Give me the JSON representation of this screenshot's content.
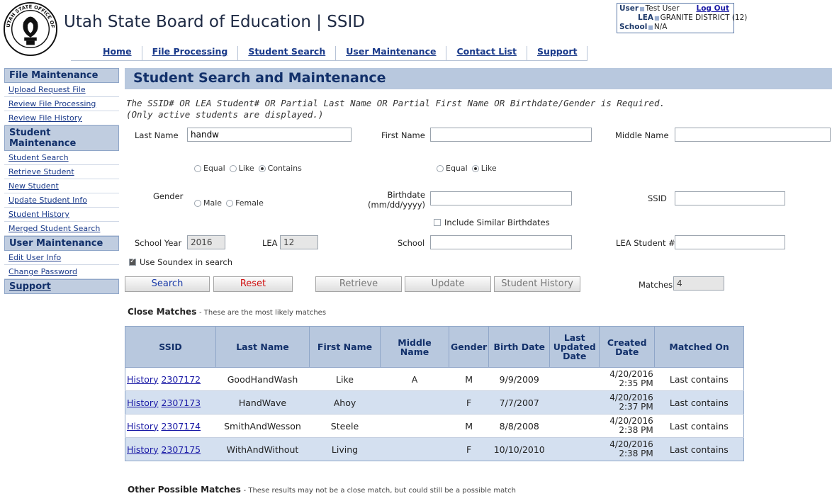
{
  "header": {
    "title": "Utah State Board of Education | SSID",
    "logo_text": "UTAH STATE OFFICE OF EDUCATION",
    "user_label": "User",
    "user_value": "Test User",
    "logout": "Log Out",
    "lea_label": "LEA",
    "lea_value": "GRANITE DISTRICT (12)",
    "school_label": "School",
    "school_value": "N/A",
    "nav": [
      "Home",
      "File Processing",
      "Student Search",
      "User Maintenance",
      "Contact List",
      "Support"
    ]
  },
  "sidebar": {
    "file_header": "File Maintenance",
    "file_items": [
      "Upload Request File",
      "Review File Processing",
      "Review File History"
    ],
    "student_header": "Student Maintenance",
    "student_items": [
      "Student Search",
      "Retrieve Student",
      "New Student",
      "Update Student Info",
      "Student History",
      "Merged Student Search"
    ],
    "user_header": "User Maintenance",
    "user_items": [
      "Edit User Info",
      "Change Password"
    ],
    "support_header": "Support"
  },
  "main": {
    "title": "Student Search and Maintenance",
    "instruction_1": "The SSID# OR LEA Student# OR Partial Last Name OR Partial First Name OR Birthdate/Gender is Required.",
    "instruction_2": "(Only active students are displayed.)"
  },
  "form": {
    "last_name_label": "Last Name",
    "last_name_value": "handw",
    "first_name_label": "First Name",
    "first_name_value": "",
    "middle_name_label": "Middle Name",
    "middle_name_value": "",
    "last_match_options": [
      "Equal",
      "Like",
      "Contains"
    ],
    "last_match_selected": "Contains",
    "first_match_options": [
      "Equal",
      "Like"
    ],
    "first_match_selected": "Like",
    "gender_label": "Gender",
    "gender_options": [
      "Male",
      "Female"
    ],
    "birthdate_label": "Birthdate",
    "birthdate_hint": "(mm/dd/yyyy)",
    "ssid_label": "SSID",
    "include_similar_label": "Include Similar Birthdates",
    "include_similar_checked": false,
    "school_year_label": "School Year",
    "school_year_value": "2016",
    "lea_label": "LEA",
    "lea_value": "12",
    "school_label": "School",
    "lea_student_label": "LEA Student #",
    "soundex_label": "Use Soundex in search",
    "soundex_checked": true,
    "buttons": {
      "search": "Search",
      "reset": "Reset",
      "retrieve": "Retrieve",
      "update": "Update",
      "history": "Student History"
    },
    "matches_label": "Matches",
    "matches_value": "4"
  },
  "close_matches": {
    "heading": "Close Matches",
    "desc": "- These are the most likely matches",
    "columns": [
      "SSID",
      "Last Name",
      "First Name",
      "Middle Name",
      "Gender",
      "Birth Date",
      "Last Updated Date",
      "Created Date",
      "Matched On"
    ],
    "rows": [
      {
        "history": "History",
        "ssid": "2307172",
        "last": "GoodHandWash",
        "first": "Like",
        "middle": "A",
        "gender": "M",
        "birth": "9/9/2009",
        "updated": "",
        "created_date": "4/20/2016",
        "created_time": "2:35 PM",
        "matched": "Last contains"
      },
      {
        "history": "History",
        "ssid": "2307173",
        "last": "HandWave",
        "first": "Ahoy",
        "middle": "",
        "gender": "F",
        "birth": "7/7/2007",
        "updated": "",
        "created_date": "4/20/2016",
        "created_time": "2:37 PM",
        "matched": "Last contains"
      },
      {
        "history": "History",
        "ssid": "2307174",
        "last": "SmithAndWesson",
        "first": "Steele",
        "middle": "",
        "gender": "M",
        "birth": "8/8/2008",
        "updated": "",
        "created_date": "4/20/2016",
        "created_time": "2:38 PM",
        "matched": "Last contains"
      },
      {
        "history": "History",
        "ssid": "2307175",
        "last": "WithAndWithout",
        "first": "Living",
        "middle": "",
        "gender": "F",
        "birth": "10/10/2010",
        "updated": "",
        "created_date": "4/20/2016",
        "created_time": "2:38 PM",
        "matched": "Last contains"
      }
    ]
  },
  "other_matches": {
    "heading": "Other Possible Matches",
    "desc": "- These results may not be a close match, but could still be a possible match"
  }
}
